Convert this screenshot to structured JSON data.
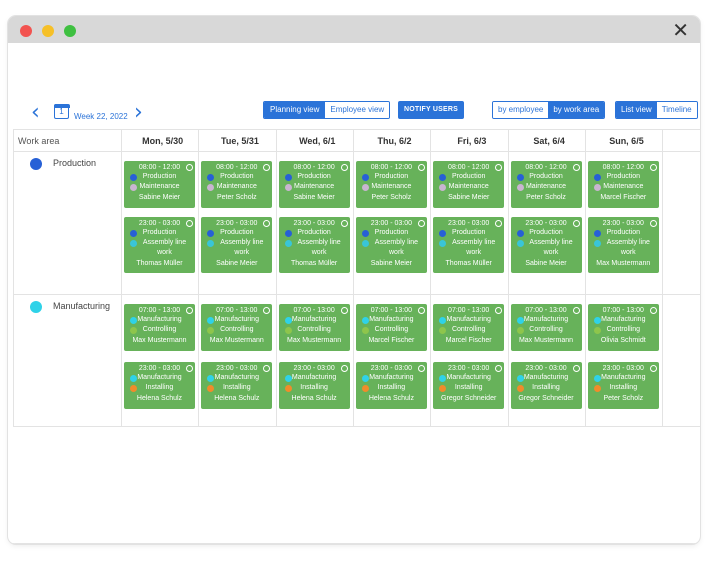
{
  "window": {
    "close_icon": "close-icon"
  },
  "toolbar": {
    "week_label": "Week 22, 2022",
    "calendar_day": "1",
    "view_options": [
      "Planning view",
      "Employee view"
    ],
    "notify_label": "NOTIFY USERS",
    "group_options": [
      "by employee",
      "by work area"
    ],
    "layout_options": [
      "List view",
      "Timeline"
    ]
  },
  "grid": {
    "work_area_header": "Work area",
    "days": [
      "Mon, 5/30",
      "Tue, 5/31",
      "Wed, 6/1",
      "Thu, 6/2",
      "Fri, 6/3",
      "Sat, 6/4",
      "Sun, 6/5"
    ]
  },
  "colors": {
    "Production": "#2760d6",
    "Maintenance": "#c9b5d0",
    "Assembly line work": "#39c5d8",
    "Manufacturing": "#2fd2e8",
    "Controlling": "#8ec54c",
    "Installing": "#f08c2b",
    "shift_green": "#67b25a",
    "accent_blue": "#2b73d8"
  },
  "sections": [
    {
      "name": "Production",
      "color": "#2760d6",
      "rows": [
        {
          "time": "08:00 - 12:00",
          "areas": [
            "Production",
            "Maintenance"
          ],
          "employees": [
            "Sabine Meier",
            "Peter Scholz",
            "Sabine Meier",
            "Peter Scholz",
            "Sabine Meier",
            "Peter Scholz",
            "Marcel Fischer"
          ]
        },
        {
          "time": "23:00 - 03:00",
          "areas": [
            "Production",
            "Assembly line work"
          ],
          "employees": [
            "Thomas Müller",
            "Sabine Meier",
            "Thomas Müller",
            "Sabine Meier",
            "Thomas Müller",
            "Sabine Meier",
            "Max Mustermann"
          ]
        }
      ]
    },
    {
      "name": "Manufacturing",
      "color": "#2fd2e8",
      "rows": [
        {
          "time": "07:00 - 13:00",
          "areas": [
            "Manufacturing",
            "Controlling"
          ],
          "employees": [
            "Max Mustermann",
            "Max Mustermann",
            "Max Mustermann",
            "Marcel Fischer",
            "Marcel Fischer",
            "Max Mustermann",
            "Olivia Schmidt"
          ]
        },
        {
          "time": "23:00 - 03:00",
          "areas": [
            "Manufacturing",
            "Installing"
          ],
          "employees": [
            "Helena Schulz",
            "Helena Schulz",
            "Helena Schulz",
            "Helena Schulz",
            "Gregor Schneider",
            "Gregor Schneider",
            "Peter Scholz"
          ]
        }
      ]
    }
  ]
}
